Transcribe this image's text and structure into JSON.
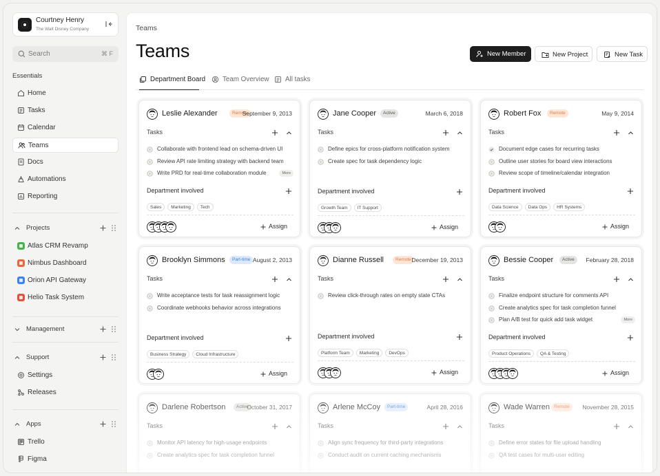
{
  "user": {
    "name": "Courtney Henry",
    "company": "The Walt Disney Company"
  },
  "search": {
    "placeholder": "Search",
    "shortcut": "⌘ F"
  },
  "sidebar": {
    "essentials_label": "Essentials",
    "nav": [
      {
        "label": "Home",
        "icon": "home-icon"
      },
      {
        "label": "Tasks",
        "icon": "tasks-icon"
      },
      {
        "label": "Calendar",
        "icon": "calendar-icon"
      },
      {
        "label": "Teams",
        "icon": "teams-icon",
        "active": true
      },
      {
        "label": "Docs",
        "icon": "docs-icon"
      },
      {
        "label": "Automations",
        "icon": "automations-icon"
      },
      {
        "label": "Reporting",
        "icon": "reporting-icon"
      }
    ],
    "projects_label": "Projects",
    "projects": [
      {
        "label": "Atlas CRM Revamp",
        "color": "#4caf50"
      },
      {
        "label": "Nimbus Dashboard",
        "color": "#f0643c"
      },
      {
        "label": "Orion API Gateway",
        "color": "#3b82f6"
      },
      {
        "label": "Helio Task System",
        "color": "#ef4d3c"
      }
    ],
    "management_label": "Management",
    "support_label": "Support",
    "support": [
      {
        "label": "Settings",
        "icon": "settings-icon"
      },
      {
        "label": "Releases",
        "icon": "releases-icon"
      }
    ],
    "apps_label": "Apps",
    "apps": [
      {
        "label": "Trello",
        "icon": "trello-icon"
      },
      {
        "label": "Figma",
        "icon": "figma-icon"
      }
    ]
  },
  "header": {
    "breadcrumb": "Teams",
    "title": "Teams",
    "new_member": "New Member",
    "new_project": "New Project",
    "new_task": "New Task"
  },
  "tabs": [
    {
      "label": "Department Board",
      "active": true
    },
    {
      "label": "Team Overview"
    },
    {
      "label": "All tasks"
    }
  ],
  "labels": {
    "tasks": "Tasks",
    "department": "Department involved",
    "assign": "Assign",
    "more": "More"
  },
  "cards": [
    {
      "name": "Leslie Alexander",
      "status": "Remote",
      "status_type": "remote",
      "date": "September 9, 2013",
      "tasks": [
        {
          "text": "Collaborate with frontend lead on schema-driven UI",
          "done": false
        },
        {
          "text": "Review API rate limiting strategy with backend team",
          "done": false
        },
        {
          "text": "Write PRD for real-time collaboration module",
          "done": false,
          "more": true
        }
      ],
      "departments": [
        "Sales",
        "Marketing",
        "Tech"
      ],
      "members": 4
    },
    {
      "name": "Jane Cooper",
      "status": "Active",
      "status_type": "active",
      "date": "March 6, 2018",
      "tasks": [
        {
          "text": "Define epics for cross-platform notification system",
          "done": false
        },
        {
          "text": "Create spec for task dependency logic",
          "done": false
        }
      ],
      "departments": [
        "Growth Team",
        "IT Support"
      ],
      "members": 3
    },
    {
      "name": "Robert Fox",
      "status": "Remote",
      "status_type": "remote",
      "date": "May 9, 2014",
      "tasks": [
        {
          "text": "Document edge cases for recurring tasks",
          "done": true
        },
        {
          "text": "Outline user stories for board view interactions",
          "done": false
        },
        {
          "text": "Review scope of timeline/calendar integration",
          "done": false
        }
      ],
      "departments": [
        "Data Science",
        "Data Ops",
        "HR Systems"
      ],
      "members": 2
    },
    {
      "name": "Brooklyn Simmons",
      "status": "Part-time",
      "status_type": "parttime",
      "date": "August 2, 2013",
      "tasks": [
        {
          "text": "Write acceptance tests for task reassignment logic",
          "done": false
        },
        {
          "text": "Coordinate webhooks behavior across integrations",
          "done": false
        }
      ],
      "departments": [
        "Business Strategy",
        "Cloud Infrastructure"
      ],
      "members": 2
    },
    {
      "name": "Dianne Russell",
      "status": "Remote",
      "status_type": "remote",
      "date": "December 19, 2013",
      "tasks": [
        {
          "text": "Review click-through rates on empty state CTAs",
          "done": false
        }
      ],
      "departments": [
        "Platform Team",
        "Marketing",
        "DevOps"
      ],
      "members": 3
    },
    {
      "name": "Bessie Cooper",
      "status": "Active",
      "status_type": "active",
      "date": "February 28, 2018",
      "tasks": [
        {
          "text": "Finalize endpoint structure for comments API",
          "done": false
        },
        {
          "text": "Create analytics spec for task completion funnel",
          "done": false
        },
        {
          "text": "Plan A/B test for quick add task widget",
          "done": false,
          "more": true
        }
      ],
      "departments": [
        "Product Operations",
        "QA & Testing"
      ],
      "members": 4
    },
    {
      "name": "Darlene Robertson",
      "status": "Active",
      "status_type": "active",
      "date": "October 31, 2017",
      "tasks": [
        {
          "text": "Monitor API latency for high-usage endpoints",
          "done": false
        },
        {
          "text": "Create analytics spec for task completion funnel",
          "done": false
        }
      ],
      "departments": [],
      "members": 0
    },
    {
      "name": "Arlene McCoy",
      "status": "Part-time",
      "status_type": "parttime",
      "date": "April 28, 2016",
      "tasks": [
        {
          "text": "Align sync frequency for third-party integrations",
          "done": false
        },
        {
          "text": "Conduct audit on current caching mechanisms",
          "done": false
        }
      ],
      "departments": [],
      "members": 0
    },
    {
      "name": "Wade Warren",
      "status": "Remote",
      "status_type": "remote",
      "date": "November 28, 2015",
      "tasks": [
        {
          "text": "Define error states for file upload handling",
          "done": false
        },
        {
          "text": "QA test cases for multi-user editing",
          "done": false
        }
      ],
      "departments": [],
      "members": 0
    }
  ]
}
